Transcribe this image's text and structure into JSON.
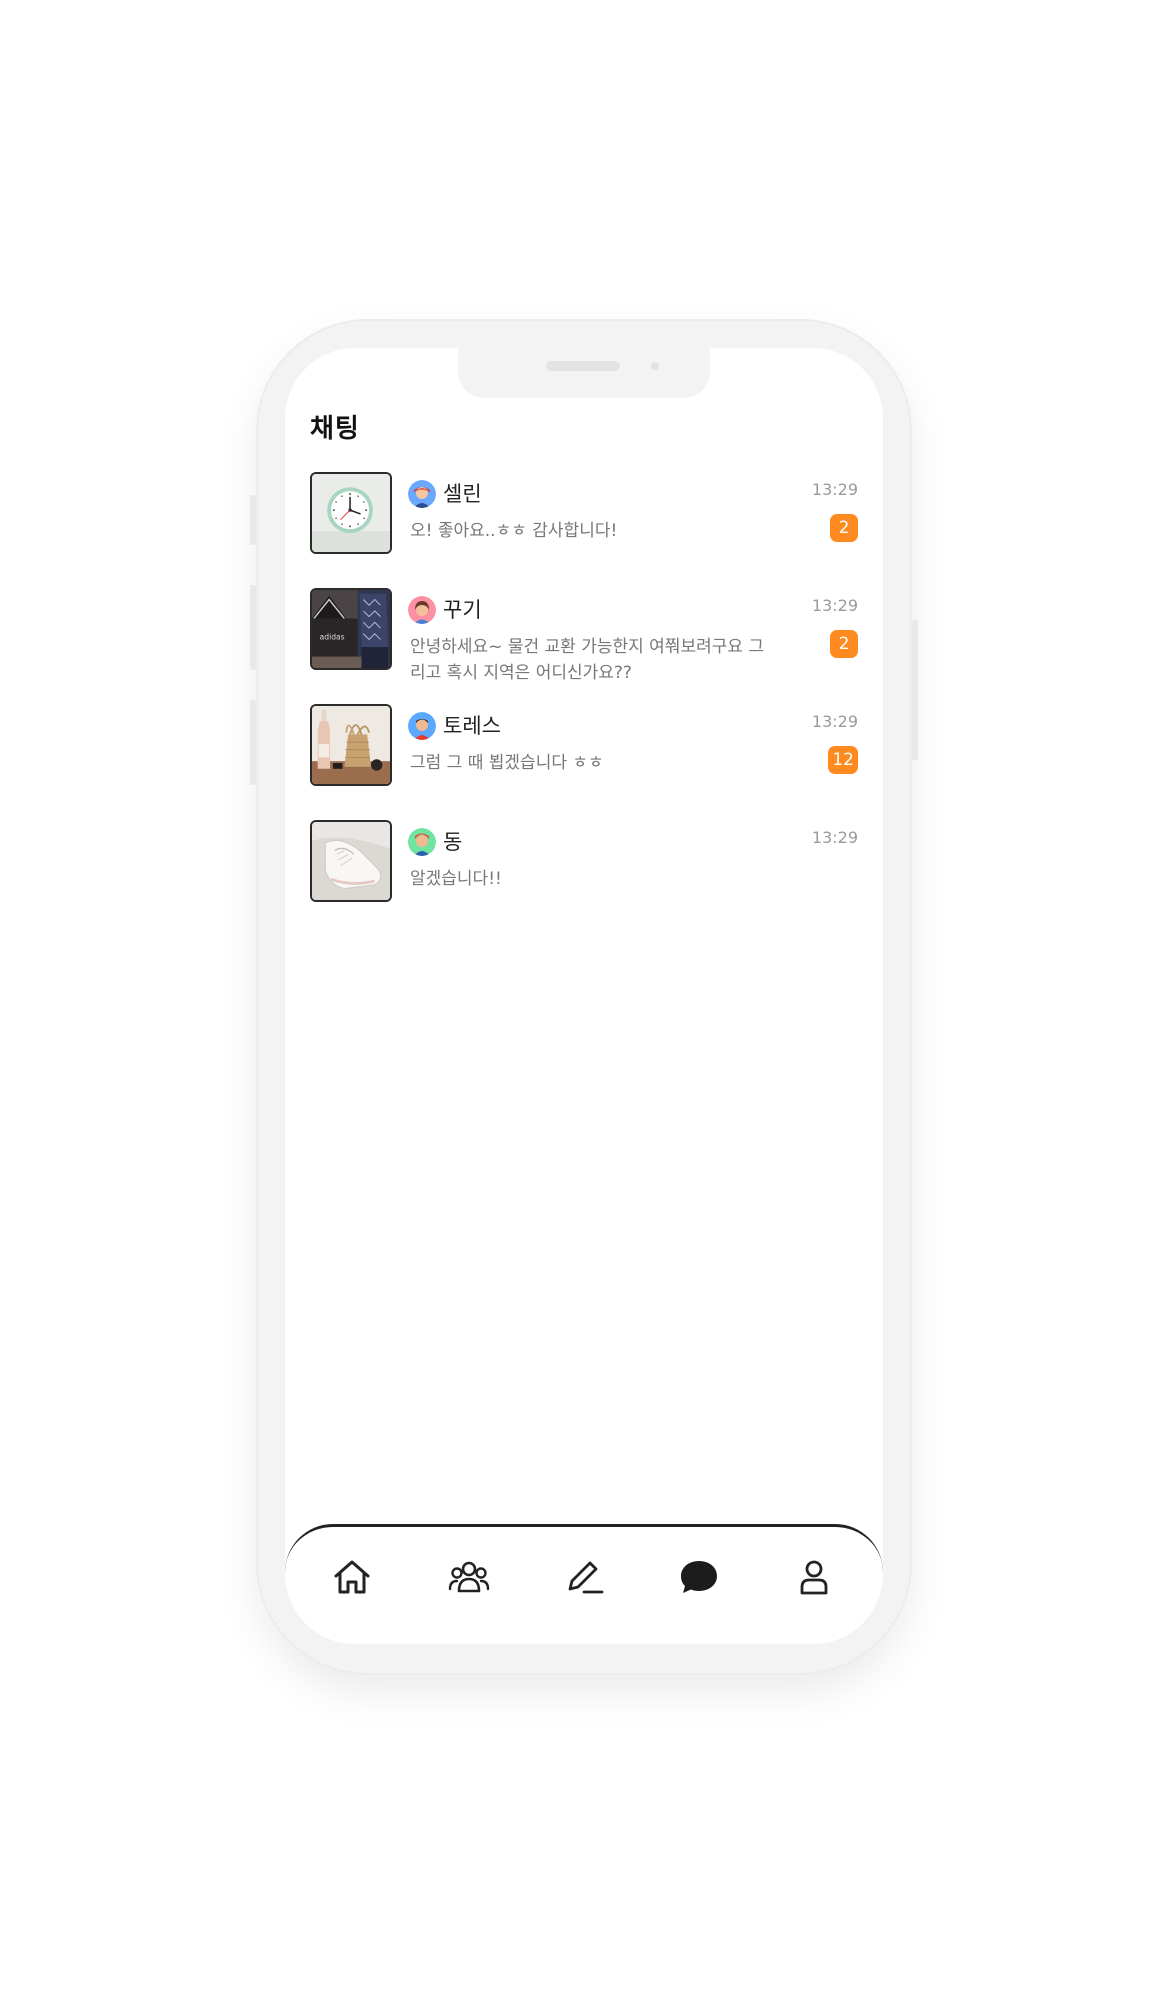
{
  "header": {
    "title": "채팅"
  },
  "chats": [
    {
      "name": "셀린",
      "message": "오! 좋아요..ㅎㅎ 감사합니다!",
      "time": "13:29",
      "badge": "2",
      "thumb": "wall-clock",
      "avatar_color": "#6aa7ff"
    },
    {
      "name": "꾸기",
      "message": "안녕하세요~ 물건 교환 가능한지 여쭤보려구요 그리고 혹시 지역은 어디신가요??",
      "time": "13:29",
      "badge": "2",
      "thumb": "sneaker-box",
      "avatar_color": "#ff8fa3"
    },
    {
      "name": "토레스",
      "message": "그럼 그 때 뵙겠습니다 ㅎㅎ",
      "time": "13:29",
      "badge": "12",
      "thumb": "bottle-vase",
      "avatar_color": "#5aa8ff"
    },
    {
      "name": "동",
      "message": "알겠습니다!!",
      "time": "13:29",
      "badge": "",
      "thumb": "white-sneaker",
      "avatar_color": "#6fe3a0"
    }
  ],
  "nav": {
    "items": [
      "home-icon",
      "community-icon",
      "write-icon",
      "chat-icon",
      "profile-icon"
    ],
    "active": "chat-icon"
  },
  "colors": {
    "accent": "#ff8a1f",
    "text": "#222222",
    "muted": "#777777"
  }
}
